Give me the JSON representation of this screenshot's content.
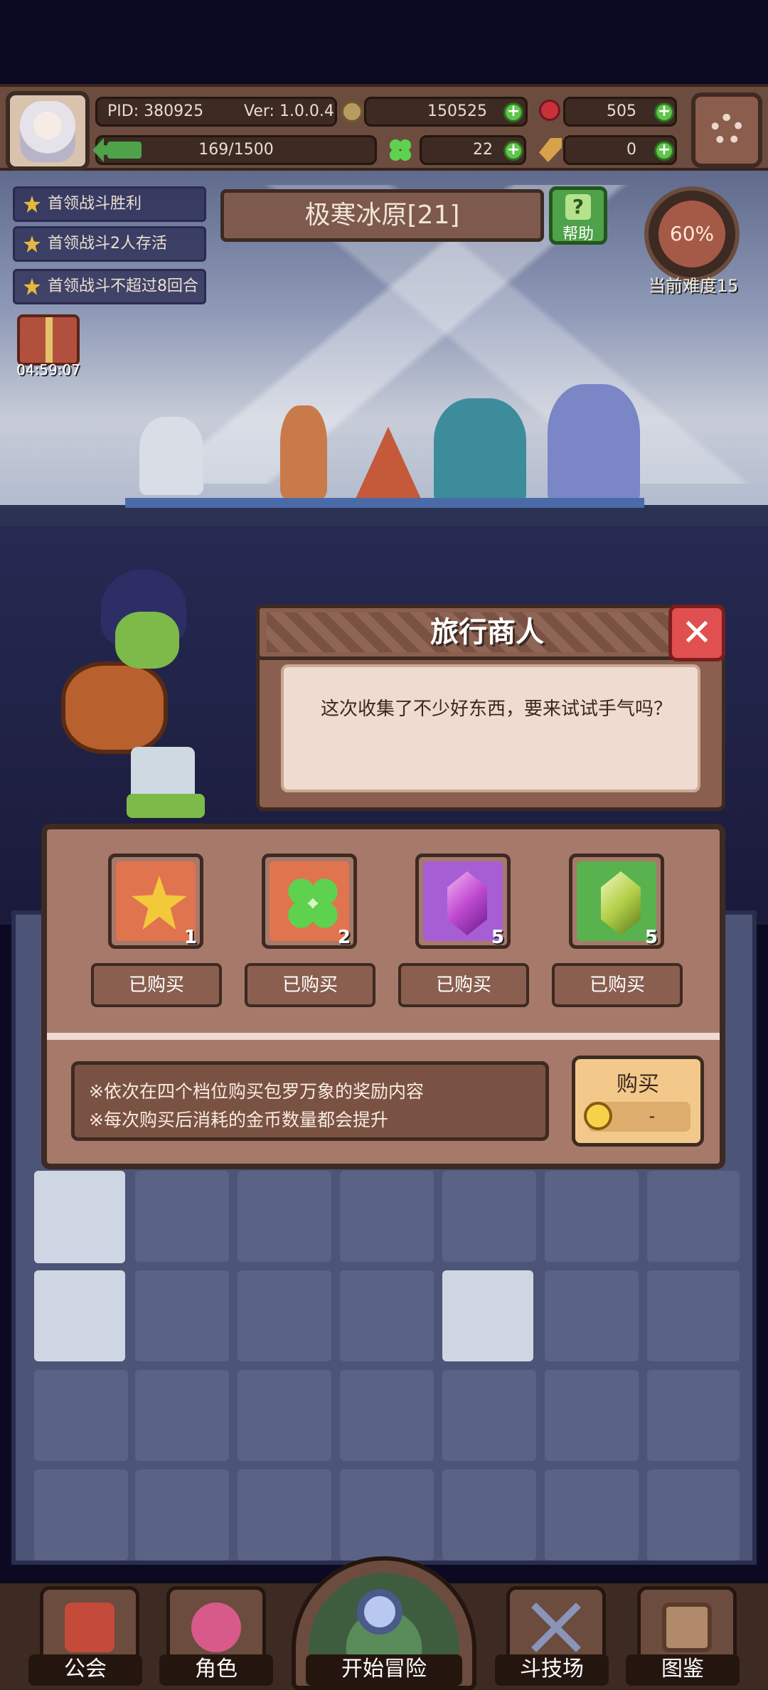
{
  "player": {
    "pid": "PID: 380925",
    "version": "Ver: 1.0.0.4",
    "coins": "150525",
    "gems": "505",
    "energy": "169/1500",
    "clovers": "22",
    "keys": "0"
  },
  "quests": [
    {
      "label": "首领战斗胜利"
    },
    {
      "label": "首领战斗2人存活"
    },
    {
      "label": "首领战斗不超过8回合"
    }
  ],
  "stage": {
    "title": "极寒冰原[21]",
    "help_label": "帮助",
    "difficulty_percent": "60%",
    "difficulty_label": "当前难度15",
    "gift_timer": "04:59:07"
  },
  "dialog": {
    "title": "旅行商人",
    "message": "这次收集了不少好东西，要来试试手气吗？",
    "close_symbol": "✕"
  },
  "shop": {
    "items": [
      {
        "icon": "star-icon",
        "qty": "1",
        "status": "已购买",
        "color": "#e0744e"
      },
      {
        "icon": "clover-icon",
        "qty": "2",
        "status": "已购买",
        "color": "#e0744e"
      },
      {
        "icon": "purple-gem-icon",
        "qty": "5",
        "status": "已购买",
        "color": "#a75ed4"
      },
      {
        "icon": "green-gem-icon",
        "qty": "5",
        "status": "已购买",
        "color": "#58b24e"
      }
    ],
    "info_lines": [
      "※依次在四个档位购买包罗万象的奖励内容",
      "※每次购买后消耗的金币数量都会提升"
    ],
    "buy_label": "购买",
    "buy_price": "-"
  },
  "nav": {
    "guild": "公会",
    "character": "角色",
    "adventure": "开始冒险",
    "arena": "斗技场",
    "codex": "图鉴"
  },
  "colors": {
    "panel_brown": "#a6796a",
    "dark_brown": "#3d2a22",
    "accent_green": "#5fc44b",
    "close_red": "#e05050",
    "gold": "#f3c93c"
  }
}
